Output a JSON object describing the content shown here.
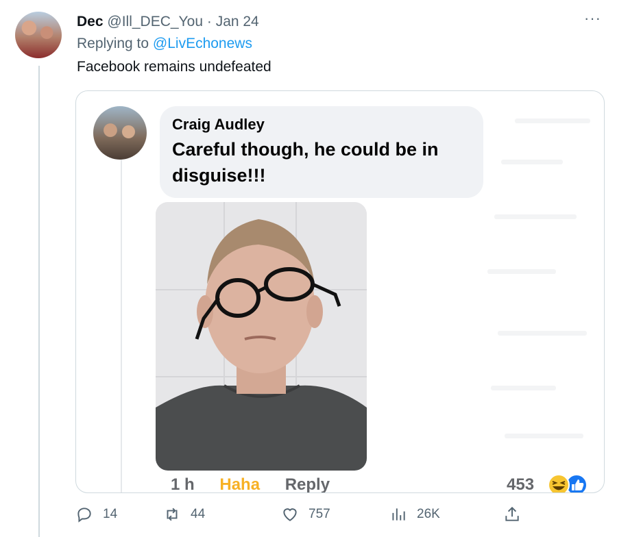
{
  "tweet": {
    "display_name": "Dec",
    "handle": "@Ill_DEC_You",
    "separator": "·",
    "date": "Jan 24",
    "more_label": "···",
    "replying_prefix": "Replying to",
    "replying_handle": "@LivEchonews",
    "text": "Facebook remains undefeated"
  },
  "embedded": {
    "author": "Craig Audley",
    "comment": "Careful though, he could be in disguise!!!",
    "time": "1 h",
    "haha_label": "Haha",
    "reply_label": "Reply",
    "reaction_count": "453",
    "reaction_icons": [
      "haha-icon",
      "like-icon"
    ]
  },
  "actions": {
    "replies": "14",
    "retweets": "44",
    "likes": "757",
    "views": "26K"
  },
  "colors": {
    "link": "#1d9bf0",
    "muted": "#536471",
    "haha": "#f7b125",
    "like_blue": "#1877f2"
  }
}
